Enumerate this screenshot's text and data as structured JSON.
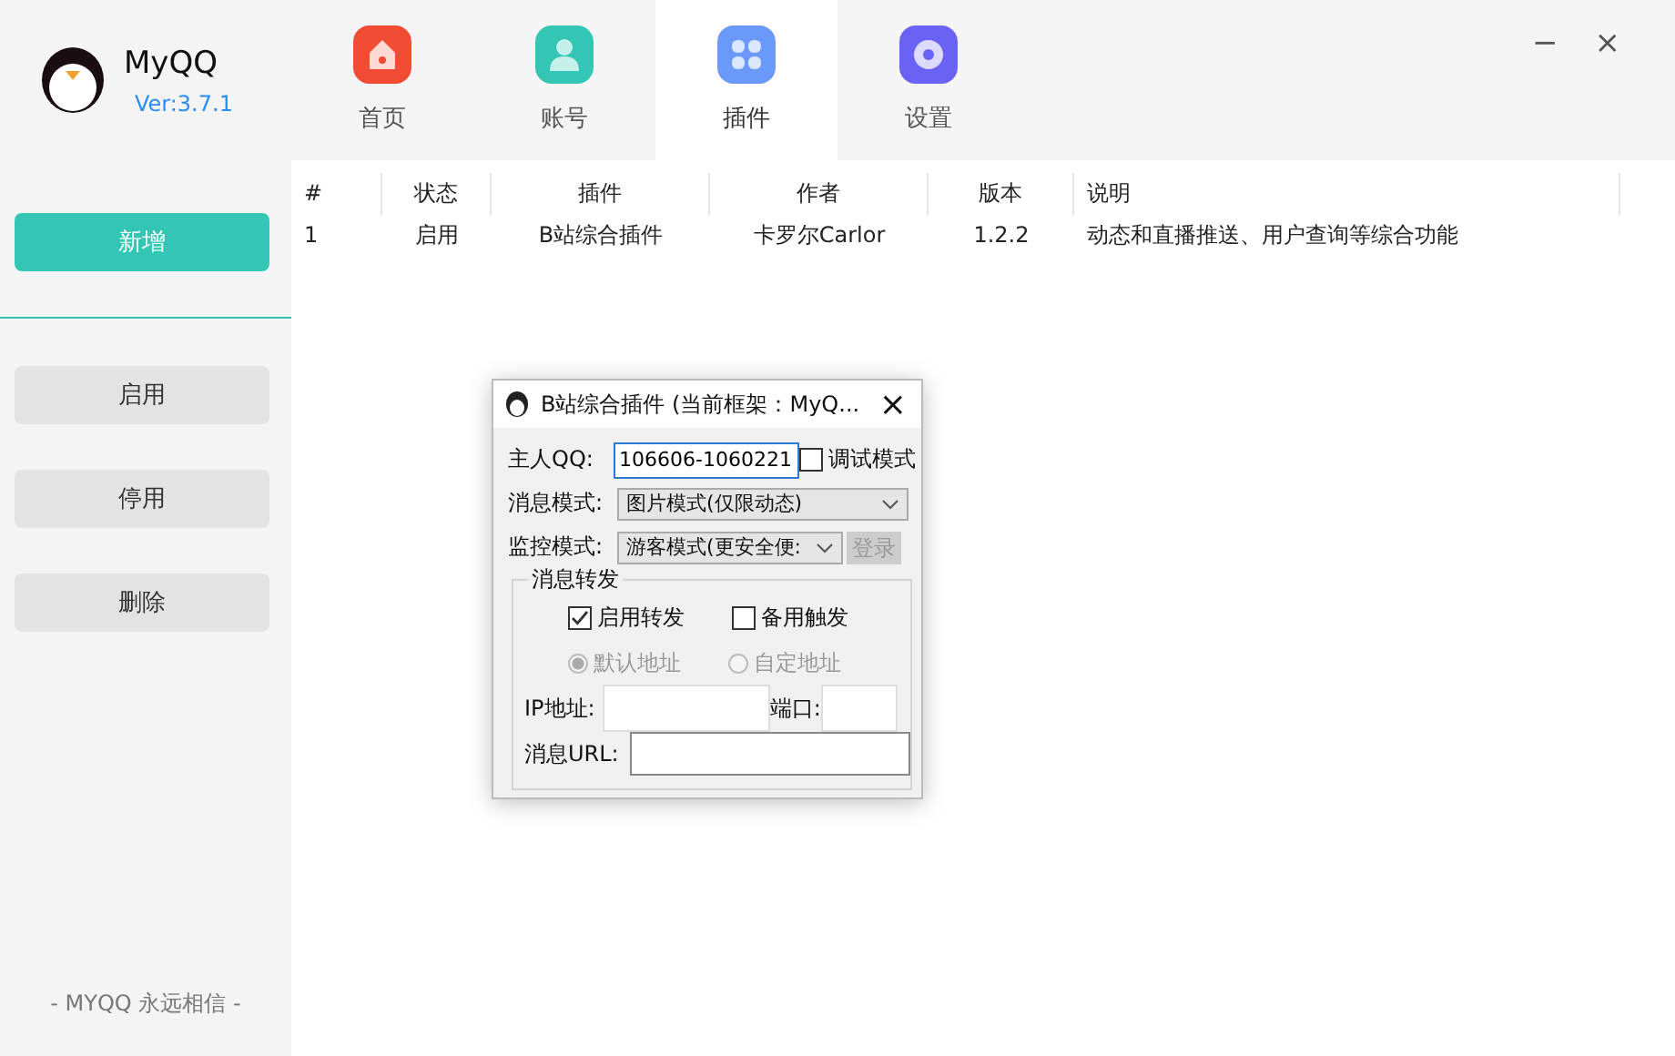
{
  "app": {
    "name": "MyQQ",
    "version": "Ver:3.7.1"
  },
  "window_controls": [
    "−",
    "×"
  ],
  "tabs": [
    {
      "label": "首页",
      "selected": false
    },
    {
      "label": "账号",
      "selected": false
    },
    {
      "label": "插件",
      "selected": true
    },
    {
      "label": "设置",
      "selected": false
    }
  ],
  "sidebar": {
    "buttons": [
      {
        "label": "新增",
        "kind": "primary"
      },
      {
        "label": "启用",
        "kind": "normal"
      },
      {
        "label": "停用",
        "kind": "normal"
      },
      {
        "label": "删除",
        "kind": "normal"
      }
    ],
    "footer": "- MYQQ 永远相信 -"
  },
  "table": {
    "columns": [
      "#",
      "状态",
      "插件",
      "作者",
      "版本",
      "说明"
    ],
    "rows": [
      [
        "1",
        "启用",
        "B站综合插件",
        "卡罗尔Carlor",
        "1.2.2",
        "动态和直播推送、用户查询等综合功能"
      ]
    ]
  },
  "dialog": {
    "title": "B站综合插件 (当前框架：MyQ...",
    "close": "×",
    "owner_qq": {
      "label": "主人QQ:",
      "value": "106606-1060221"
    },
    "debug_mode": {
      "label": "调试模式",
      "checked": false
    },
    "message_mode": {
      "label": "消息模式:",
      "value": "图片模式(仅限动态)"
    },
    "monitor_mode": {
      "label": "监控模式:",
      "value": "游客模式(更安全便:"
    },
    "login_button": {
      "label": "登录",
      "disabled": true
    },
    "forward_group": {
      "title": "消息转发",
      "checkboxes": [
        {
          "label": "启用转发",
          "checked": true
        },
        {
          "label": "备用触发",
          "checked": false
        }
      ],
      "radios": [
        {
          "label": "默认地址",
          "selected": true,
          "disabled": true
        },
        {
          "label": "自定地址",
          "selected": false,
          "disabled": true
        }
      ],
      "ip_label": "IP地址:",
      "port_label": "端口:",
      "url_label": "消息URL:"
    }
  }
}
